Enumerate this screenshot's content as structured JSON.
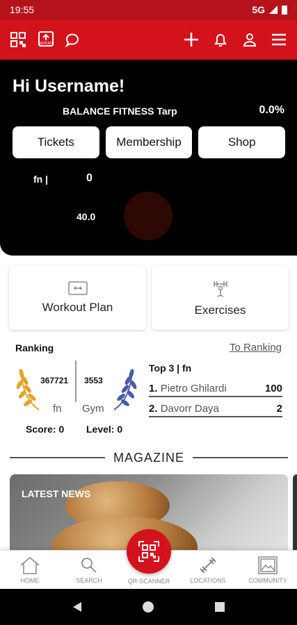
{
  "status_bar": {
    "time": "19:55",
    "network": "5G"
  },
  "header": {
    "icons_left": [
      "qr-code-icon",
      "report-icon",
      "chat-icon"
    ],
    "report_label": "REPORT",
    "icons_right": [
      "plus-icon",
      "bell-icon",
      "user-icon",
      "menu-icon"
    ]
  },
  "hero": {
    "greeting": "Hi Username!",
    "studio": "BALANCE FITNESS Tarp",
    "percent": "0.0%",
    "buttons": [
      "Tickets",
      "Membership",
      "Shop"
    ],
    "fn_label": "fn |",
    "fn_value": "0",
    "value2": "40.0"
  },
  "cards": [
    {
      "label": "Workout Plan",
      "icon": "workout-plan-icon"
    },
    {
      "label": "Exercises",
      "icon": "exercises-icon"
    }
  ],
  "ranking": {
    "title": "Ranking",
    "link": "To Ranking",
    "fn_count": "367721",
    "gym_count": "3553",
    "fn_label": "fn",
    "gym_label": "Gym",
    "score": "Score: 0",
    "level": "Level: 0",
    "top_title": "Top 3 | fn",
    "top": [
      {
        "rank": "1.",
        "name": "Pietro Ghilardi",
        "points": "100"
      },
      {
        "rank": "2.",
        "name": "Davorr Daya",
        "points": "2"
      }
    ],
    "colors": {
      "left_laurel": "#e0a526",
      "right_laurel": "#4a5aa8"
    }
  },
  "magazine": {
    "title": "MAGAZINE",
    "latest": "LATEST NEWS"
  },
  "bottom_nav": {
    "items": [
      {
        "label": "HOME",
        "icon": "home-icon"
      },
      {
        "label": "SEARCH",
        "icon": "search-icon"
      },
      {
        "label": "QR-SCANNER",
        "icon": "qr-scanner-icon"
      },
      {
        "label": "LOCATIONS",
        "icon": "dumbbell-icon"
      },
      {
        "label": "COMMUNITY",
        "icon": "community-icon"
      }
    ]
  },
  "theme": {
    "brand_red": "#d4121b",
    "status_red": "#b5121b",
    "hero_bg": "#000000"
  }
}
